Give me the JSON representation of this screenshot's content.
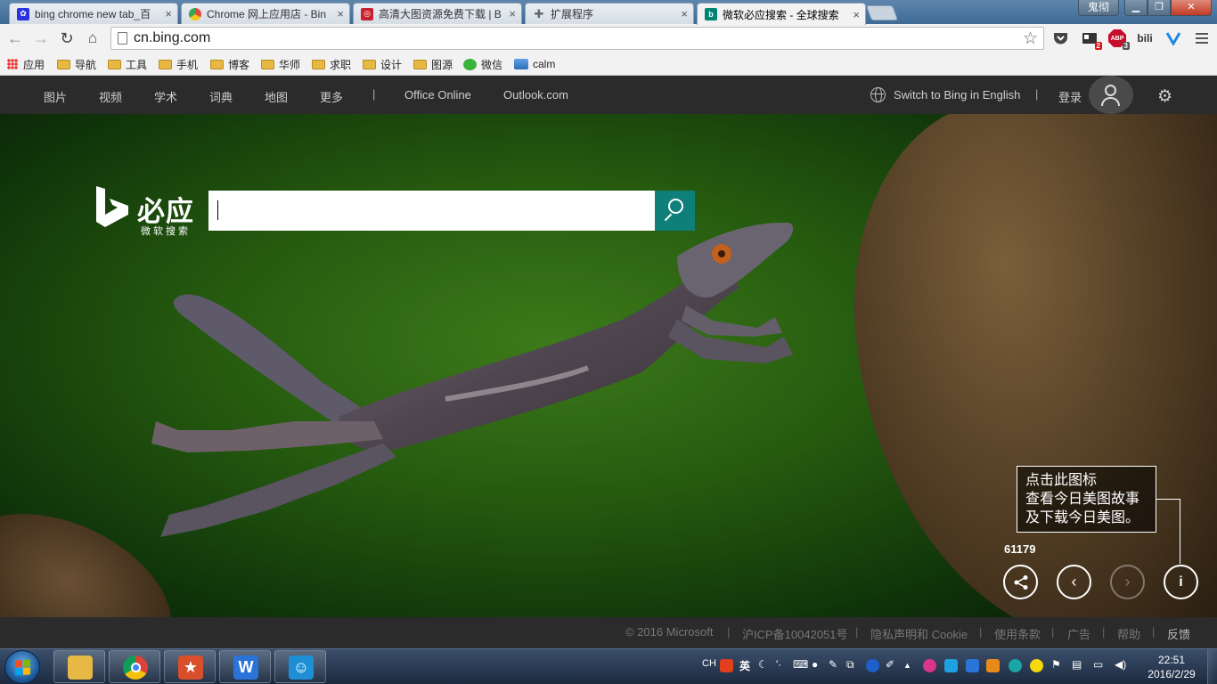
{
  "browser": {
    "tabs": [
      {
        "title": "bing chrome new tab_百",
        "favicon": "baidu-paw-icon",
        "color": "#2932e1"
      },
      {
        "title": "Chrome 网上应用店 - Bin",
        "favicon": "chrome-webstore-icon",
        "color": "#e8473c"
      },
      {
        "title": "高清大图资源免费下载 | B",
        "favicon": "image-site-icon",
        "color": "#c8202f"
      },
      {
        "title": "扩展程序",
        "favicon": "puzzle-icon",
        "color": "#666666"
      },
      {
        "title": "微软必应搜索 - 全球搜索",
        "favicon": "bing-icon",
        "color": "#008373"
      }
    ],
    "window_user": "鬼彻",
    "url": "cn.bing.com",
    "bookmarks": [
      {
        "label": "应用",
        "icon": "apps-grid-icon"
      },
      {
        "label": "导航",
        "icon": "folder-icon"
      },
      {
        "label": "工具",
        "icon": "folder-icon"
      },
      {
        "label": "手机",
        "icon": "folder-icon"
      },
      {
        "label": "博客",
        "icon": "folder-icon"
      },
      {
        "label": "华师",
        "icon": "folder-icon"
      },
      {
        "label": "求职",
        "icon": "folder-icon"
      },
      {
        "label": "设计",
        "icon": "folder-icon"
      },
      {
        "label": "图源",
        "icon": "folder-icon"
      },
      {
        "label": "微信",
        "icon": "wechat-icon"
      },
      {
        "label": "calm",
        "icon": "calm-icon"
      }
    ],
    "extensions": {
      "reader_badge": "2",
      "abp_label": "ABP",
      "abp_badge": "3",
      "bili_label": "bili"
    }
  },
  "bing": {
    "nav": [
      "图片",
      "视频",
      "学术",
      "词典",
      "地图",
      "更多"
    ],
    "nav_extra": [
      "Office Online",
      "Outlook.com"
    ],
    "switch_lang": "Switch to Bing in English",
    "login": "登录",
    "logo_cn": "必应",
    "logo_sub": "微软搜索",
    "search_value": "",
    "tooltip": [
      "点击此图标",
      "查看今日美图故事",
      "及下载今日美图。"
    ],
    "share_count": "61179",
    "footer": [
      "© 2016 Microsoft",
      "沪ICP备10042051号",
      "隐私声明和 Cookie",
      "使用条款",
      "广告",
      "帮助",
      "反馈"
    ],
    "accent": "#0f7f7a"
  },
  "taskbar": {
    "apps": [
      {
        "name": "explorer",
        "color": "#e8b844"
      },
      {
        "name": "chrome",
        "color": "#db4437"
      },
      {
        "name": "wps-presentation",
        "color": "#d94f2b"
      },
      {
        "name": "wps-writer",
        "color": "#2a73d9"
      },
      {
        "name": "app-blue",
        "color": "#1e8fd6"
      }
    ],
    "ime_lang": "CH",
    "ime_mode": "英",
    "time": "22:51",
    "date": "2016/2/29"
  }
}
